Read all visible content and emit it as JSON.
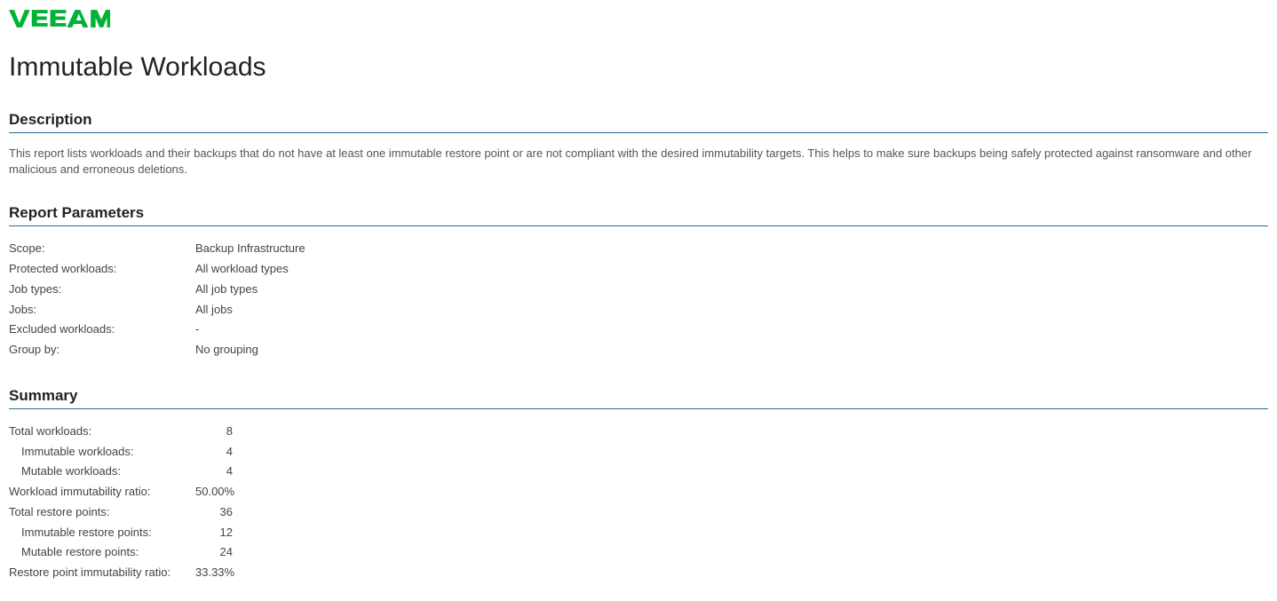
{
  "logo_text": "VEEAM",
  "page_title": "Immutable Workloads",
  "sections": {
    "description": {
      "heading": "Description",
      "text": "This report lists workloads and their backups that do not have at least one immutable restore point or are not compliant with the desired immutability targets. This helps to make sure backups being safely protected against ransomware and other malicious and erroneous deletions."
    },
    "parameters": {
      "heading": "Report Parameters",
      "rows": [
        {
          "label": "Scope:",
          "value": "Backup Infrastructure"
        },
        {
          "label": "Protected workloads:",
          "value": "All workload types"
        },
        {
          "label": "Job types:",
          "value": "All job types"
        },
        {
          "label": "Jobs:",
          "value": "All jobs"
        },
        {
          "label": "Excluded workloads:",
          "value": "-"
        },
        {
          "label": "Group by:",
          "value": "No grouping"
        }
      ]
    },
    "summary": {
      "heading": "Summary",
      "rows": [
        {
          "label": "Total workloads:",
          "value": "8",
          "indent": false
        },
        {
          "label": "Immutable workloads:",
          "value": "4",
          "indent": true
        },
        {
          "label": "Mutable workloads:",
          "value": "4",
          "indent": true
        },
        {
          "label": "Workload immutability ratio:",
          "value": "50.00%",
          "indent": false
        },
        {
          "label": "Total restore points:",
          "value": "36",
          "indent": false
        },
        {
          "label": "Immutable restore points:",
          "value": "12",
          "indent": true
        },
        {
          "label": "Mutable restore points:",
          "value": "24",
          "indent": true
        },
        {
          "label": "Restore point immutability ratio:",
          "value": "33.33%",
          "indent": false
        }
      ]
    }
  }
}
